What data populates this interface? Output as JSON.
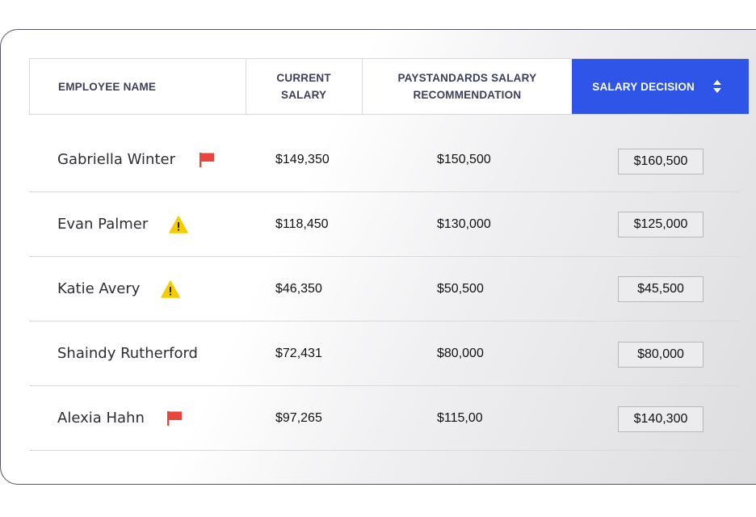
{
  "table": {
    "headers": {
      "employee_name": "EMPLOYEE NAME",
      "current_salary_line1": "CURRENT",
      "current_salary_line2": "SALARY",
      "recommendation_line1": "PAYSTANDARDS SALARY",
      "recommendation_line2": "RECOMMENDATION",
      "decision": "SALARY DECISION"
    },
    "rows": [
      {
        "name": "Gabriella Winter",
        "icon": "red-flag-icon",
        "current": "$149,350",
        "recommendation": "$150,500",
        "decision": "$160,500"
      },
      {
        "name": "Evan Palmer",
        "icon": "warning-icon",
        "current": "$118,450",
        "recommendation": "$130,000",
        "decision": "$125,000"
      },
      {
        "name": "Katie Avery",
        "icon": "warning-icon",
        "current": "$46,350",
        "recommendation": "$50,500",
        "decision": "$45,500"
      },
      {
        "name": "Shaindy Rutherford",
        "icon": "",
        "current": "$72,431",
        "recommendation": "$80,000",
        "decision": "$80,000"
      },
      {
        "name": "Alexia Hahn",
        "icon": "red-flag-icon",
        "current": "$97,265",
        "recommendation": "$115,00",
        "decision": "$140,300"
      }
    ]
  },
  "colors": {
    "accent_header": "#2f55e8",
    "flag": "#e8453c",
    "warning": "#f5cc00"
  }
}
